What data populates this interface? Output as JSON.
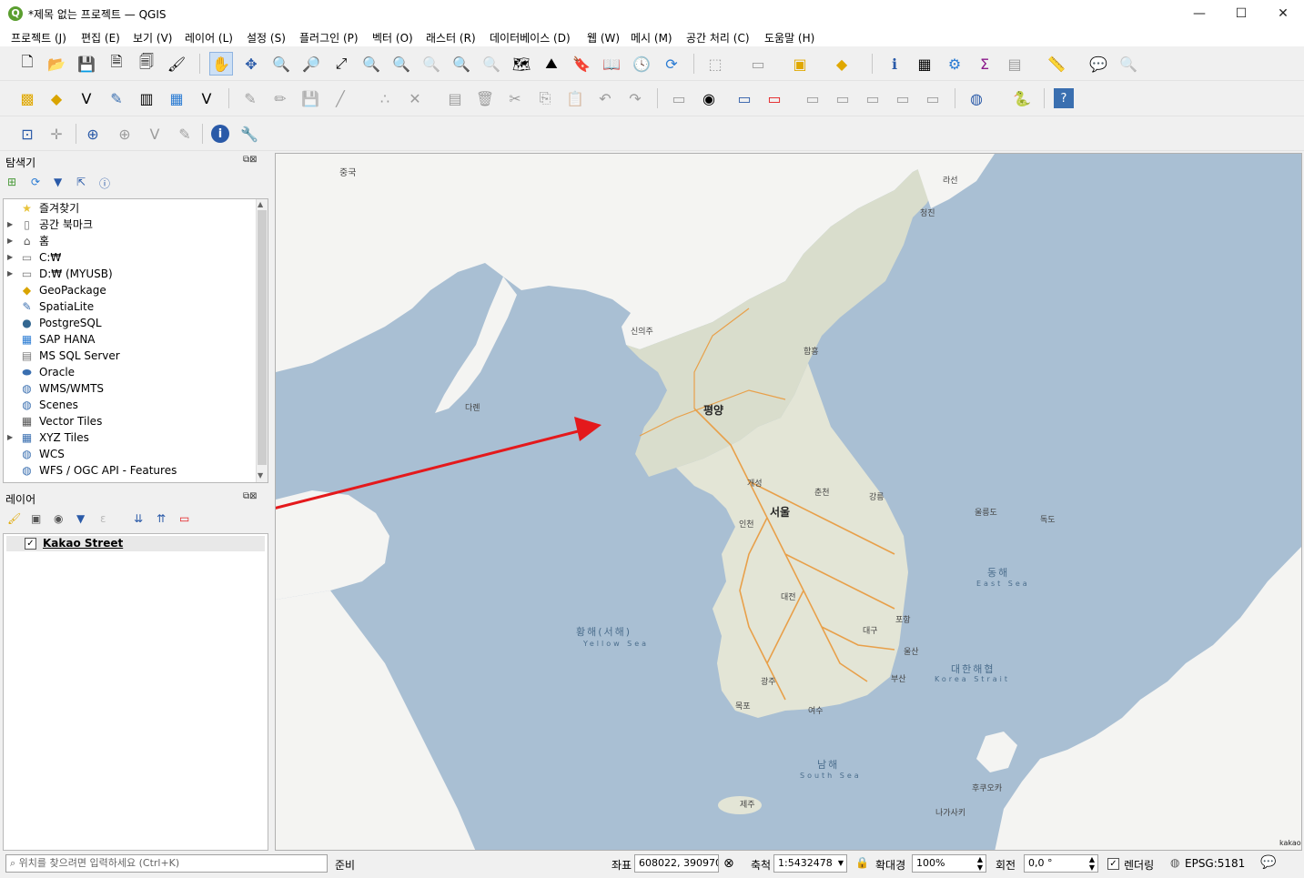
{
  "window": {
    "title": "*제목 없는 프로젝트 — QGIS",
    "minimize": "—",
    "maximize": "☐",
    "close": "✕"
  },
  "menu": [
    "프로젝트 (J)",
    "편집 (E)",
    "보기 (V)",
    "레이어 (L)",
    "설정 (S)",
    "플러그인 (P)",
    "벡터 (O)",
    "래스터 (R)",
    "데이터베이스 (D)",
    "웹 (W)",
    "메시 (M)",
    "공간 처리 (C)",
    "도움말 (H)"
  ],
  "browser": {
    "title": "탐색기",
    "items": [
      {
        "label": "즐겨찾기",
        "icon": "star-icon",
        "glyph": "★",
        "color": "#e8c33a",
        "arrow": ""
      },
      {
        "label": "공간 북마크",
        "icon": "bookmark-icon",
        "glyph": "▯",
        "color": "#777",
        "arrow": "▶"
      },
      {
        "label": "홈",
        "icon": "home-folder-icon",
        "glyph": "⌂",
        "color": "#555",
        "arrow": "▶"
      },
      {
        "label": "C:₩",
        "icon": "drive-icon",
        "glyph": "▭",
        "color": "#777",
        "arrow": "▶"
      },
      {
        "label": "D:₩ (MYUSB)",
        "icon": "drive-icon",
        "glyph": "▭",
        "color": "#777",
        "arrow": "▶"
      },
      {
        "label": "GeoPackage",
        "icon": "geopackage-icon",
        "glyph": "◆",
        "color": "#d9a400",
        "arrow": ""
      },
      {
        "label": "SpatiaLite",
        "icon": "spatialite-icon",
        "glyph": "✎",
        "color": "#3a6fb0",
        "arrow": ""
      },
      {
        "label": "PostgreSQL",
        "icon": "postgresql-icon",
        "glyph": "🐘",
        "color": "#336791",
        "arrow": ""
      },
      {
        "label": "SAP HANA",
        "icon": "sap-hana-icon",
        "glyph": "▦",
        "color": "#2a7bd3",
        "arrow": ""
      },
      {
        "label": "MS SQL Server",
        "icon": "mssql-icon",
        "glyph": "▤",
        "color": "#777",
        "arrow": ""
      },
      {
        "label": "Oracle",
        "icon": "oracle-icon",
        "glyph": "⬬",
        "color": "#3a6fb0",
        "arrow": ""
      },
      {
        "label": "WMS/WMTS",
        "icon": "globe-icon",
        "glyph": "◍",
        "color": "#3a6fb0",
        "arrow": ""
      },
      {
        "label": "Scenes",
        "icon": "globe-icon",
        "glyph": "◍",
        "color": "#3a6fb0",
        "arrow": ""
      },
      {
        "label": "Vector Tiles",
        "icon": "grid-icon",
        "glyph": "▦",
        "color": "#555",
        "arrow": ""
      },
      {
        "label": "XYZ Tiles",
        "icon": "grid-icon",
        "glyph": "▦",
        "color": "#3a6fb0",
        "arrow": "▶"
      },
      {
        "label": "WCS",
        "icon": "globe-icon",
        "glyph": "◍",
        "color": "#3a6fb0",
        "arrow": ""
      },
      {
        "label": "WFS / OGC API - Features",
        "icon": "globe-icon",
        "glyph": "◍",
        "color": "#3a6fb0",
        "arrow": ""
      }
    ]
  },
  "layers": {
    "title": "레이어",
    "items": [
      {
        "label": "Kakao Street",
        "checked": "✓"
      }
    ]
  },
  "map": {
    "attribution": "kakao",
    "labels": {
      "china": "중국",
      "pyongyang": "평양",
      "seoul": "서울",
      "yellow_sea": "황해(서해)",
      "yellow_sea_en": "Yellow Sea",
      "east_sea": "동해",
      "east_sea_en": "East Sea",
      "south_sea": "남해",
      "south_sea_en": "South Sea",
      "korea_strait": "대한해협",
      "korea_strait_en": "Korea Strait",
      "jeju": "제주",
      "busan": "부산",
      "daegu": "대구",
      "daejeon": "대전",
      "gwangju": "광주",
      "incheon": "인천",
      "ulsan": "울산",
      "dokdo": "독도",
      "ulleungdo": "울릉도",
      "hamhung": "함흥",
      "sinuiju": "신의주",
      "gaesong": "개성",
      "chuncheon": "춘천",
      "gangneung": "강릉",
      "pohang": "포항",
      "mokpo": "목포",
      "yeosu": "여수",
      "tsushima": "나가사키",
      "fukuoka": "후쿠오카",
      "dalian": "다롄",
      "rason": "라선",
      "chongjin": "청진"
    }
  },
  "status": {
    "locator_placeholder": "위치를 찾으려면 입력하세요 (Ctrl+K)",
    "ready": "준비",
    "coord_label": "좌표",
    "coord_value": "608022, 390970",
    "scale_label": "축척",
    "scale_value": "1:5432478",
    "magnifier_label": "확대경",
    "magnifier_value": "100%",
    "rotation_label": "회전",
    "rotation_value": "0,0 °",
    "render_label": "렌더링",
    "crs": "EPSG:5181"
  },
  "colors": {
    "sea": "#a9bfd3",
    "land_kr": "#dfe3d5",
    "land_other": "#f4f4f2",
    "arrow": "#e4191c",
    "road": "#e8a04a"
  }
}
